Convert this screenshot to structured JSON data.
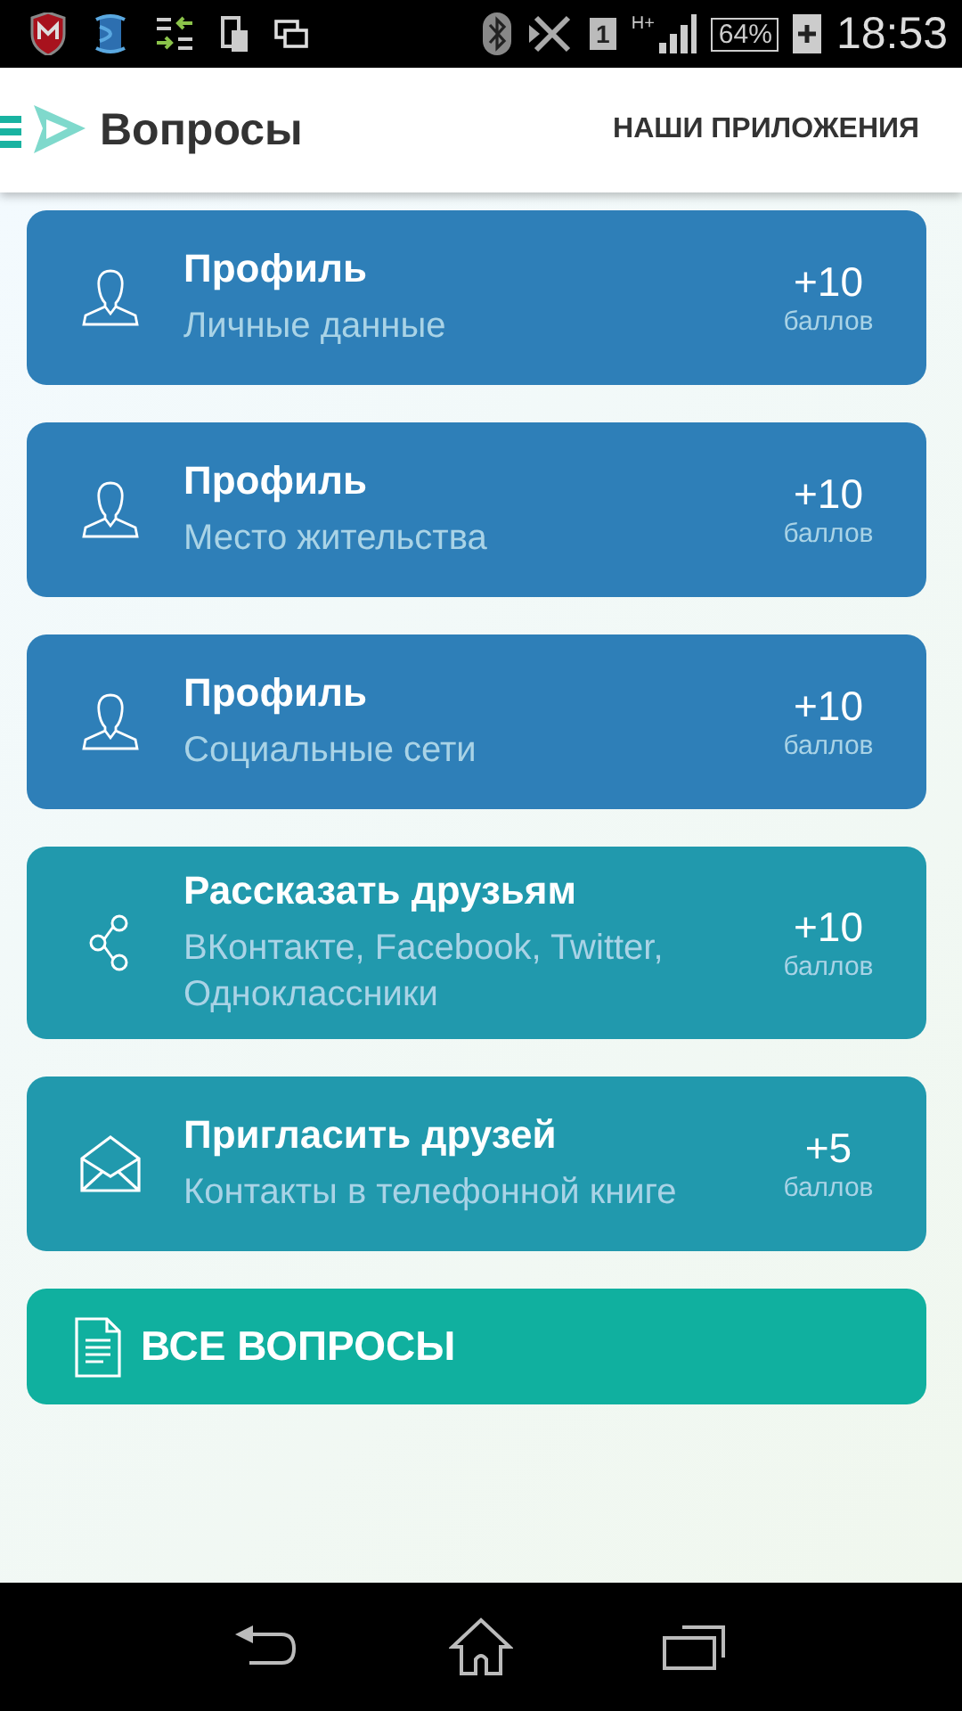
{
  "status_bar": {
    "sim": "1",
    "network": "H+",
    "battery": "64%",
    "time": "18:53"
  },
  "header": {
    "title": "Вопросы",
    "action": "НАШИ ПРИЛОЖЕНИЯ"
  },
  "cards": [
    {
      "kind": "profile",
      "title": "Профиль",
      "subtitle": "Личные данные",
      "points": "+10",
      "points_label": "баллов"
    },
    {
      "kind": "profile",
      "title": "Профиль",
      "subtitle": "Место жительства",
      "points": "+10",
      "points_label": "баллов"
    },
    {
      "kind": "profile",
      "title": "Профиль",
      "subtitle": "Социальные сети",
      "points": "+10",
      "points_label": "баллов"
    },
    {
      "kind": "share",
      "title": "Рассказать друзьям",
      "subtitle": "ВКонтакте, Facebook, Twitter, Одноклассники",
      "points": "+10",
      "points_label": "баллов"
    },
    {
      "kind": "invite",
      "title": "Пригласить друзей",
      "subtitle": "Контакты в телефонной книге",
      "points": "+5",
      "points_label": "баллов"
    }
  ],
  "all_button": {
    "label": "ВСЕ ВОПРОСЫ"
  }
}
